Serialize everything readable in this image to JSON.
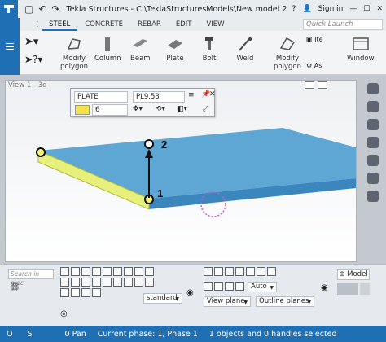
{
  "titlebar": {
    "app_title": "Tekla Structures - C:\\TeklaStructuresModels\\New model 2",
    "sign_in": "Sign in",
    "window_controls": [
      "minimize",
      "maximize",
      "close"
    ]
  },
  "tabs": [
    "STEEL",
    "CONCRETE",
    "REBAR",
    "EDIT",
    "VIEW"
  ],
  "active_tab": "STEEL",
  "search": {
    "placeholder": "Quick Launch"
  },
  "ribbon": {
    "buttons": [
      {
        "label1": "Modify",
        "label2": "polygon"
      },
      {
        "label1": "Column",
        "label2": ""
      },
      {
        "label1": "Beam",
        "label2": ""
      },
      {
        "label1": "Plate",
        "label2": ""
      },
      {
        "label1": "Bolt",
        "label2": ""
      },
      {
        "label1": "Weld",
        "label2": ""
      },
      {
        "label1": "Modify",
        "label2": "polygon"
      }
    ],
    "small_items": [
      "Ite",
      "As"
    ],
    "window_label": "Window"
  },
  "view": {
    "title": "View 1 - 3d",
    "handle_labels": [
      "1",
      "2"
    ],
    "model_colors": {
      "plate_top": "#5ea6d3",
      "plate_side": "#3b86bd",
      "selected": "#e7f07a"
    }
  },
  "plate_dialog": {
    "type": "PLATE",
    "profile": "PL9.53",
    "class": "6",
    "color": "#f4e24a"
  },
  "bottom": {
    "search_placeholder": "Search in moc",
    "select_dropdown": "standard",
    "auto_dropdown": "Auto",
    "view_plane": "View plane",
    "outline_planes": "Outline planes",
    "model_button": "Model"
  },
  "status": {
    "o": "O",
    "s": "S",
    "pan": "0 Pan",
    "phase": "Current phase: 1, Phase 1",
    "selection": "1 objects and 0 handles selected"
  }
}
